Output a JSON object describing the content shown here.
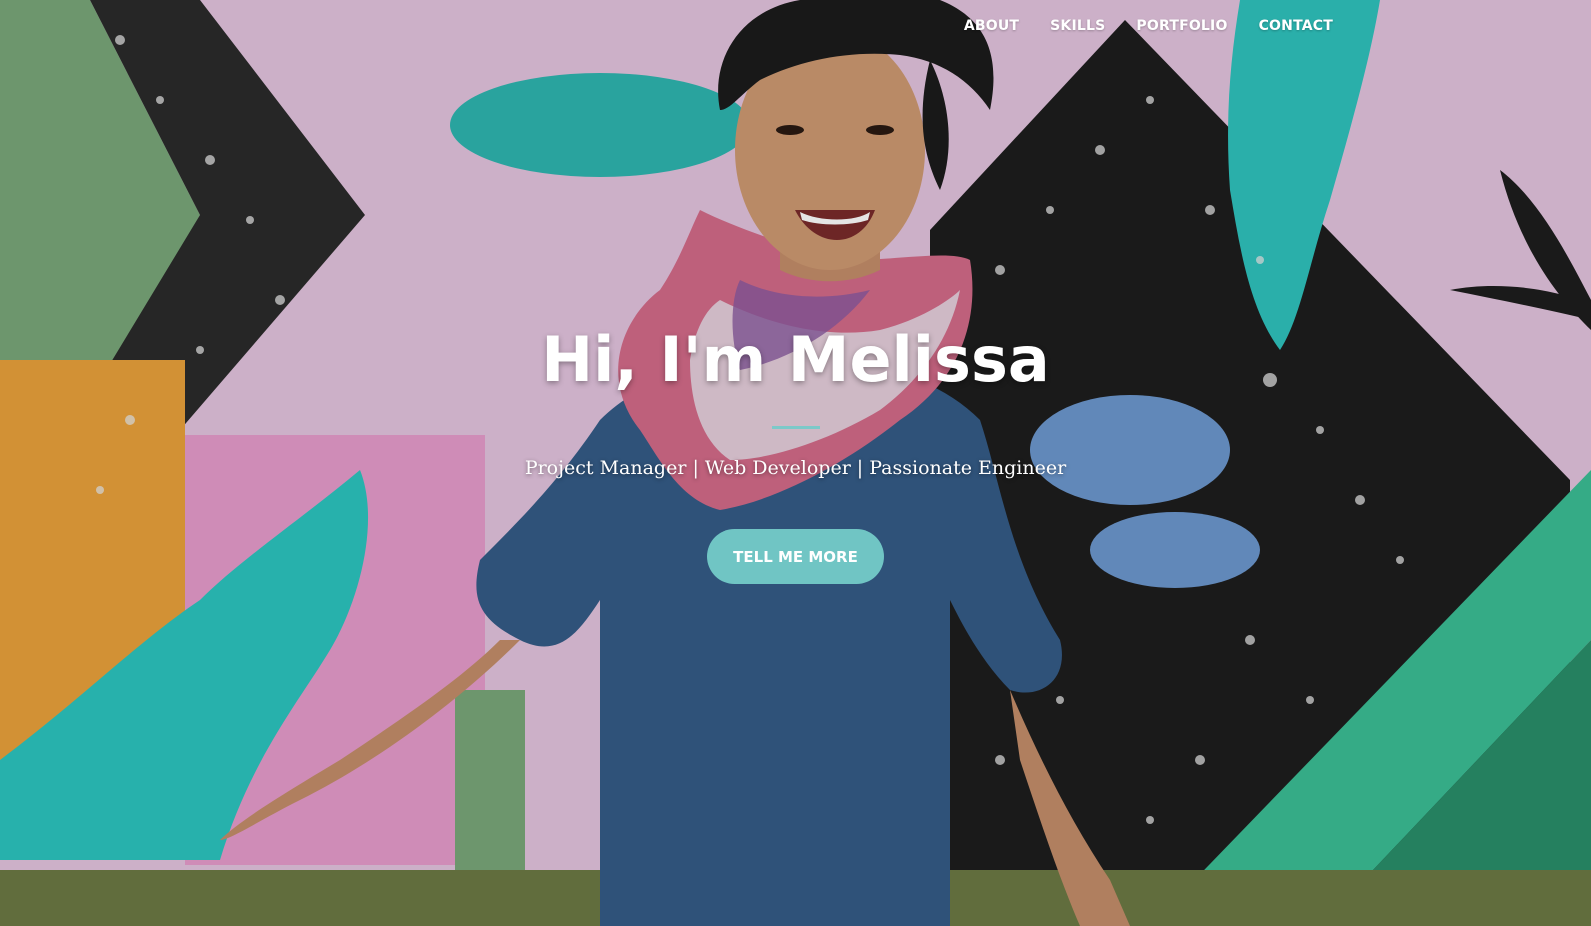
{
  "nav": {
    "items": [
      {
        "label": "ABOUT"
      },
      {
        "label": "SKILLS"
      },
      {
        "label": "PORTFOLIO"
      },
      {
        "label": "CONTACT"
      }
    ]
  },
  "hero": {
    "title": "Hi, I'm Melissa",
    "subtitle": "Project Manager | Web Developer | Passionate Engineer",
    "cta_label": "TELL ME MORE"
  },
  "colors": {
    "accent": "#70c5c4",
    "text": "#ffffff"
  }
}
